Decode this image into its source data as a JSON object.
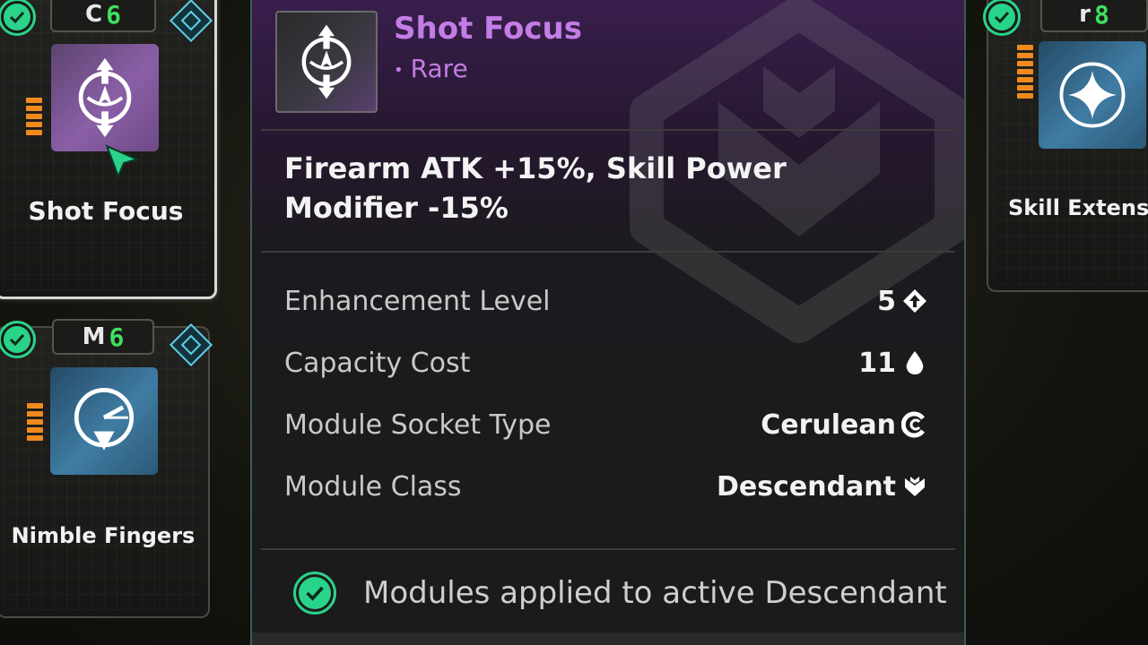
{
  "modules": {
    "shot_focus": {
      "name": "Shot Focus",
      "rarity": "Rare",
      "cost": "6",
      "socket_symbol": "C",
      "effect": "Firearm ATK +15%, Skill Power Modifier -15%",
      "enhancement_pips": 5
    },
    "nimble_fingers": {
      "name": "Nimble Fingers",
      "cost": "6",
      "socket_symbol": "M",
      "enhancement_pips": 5
    },
    "skill_extension": {
      "name": "Skill Extensi",
      "cost": "8",
      "socket_symbol": "r",
      "enhancement_pips": 7
    }
  },
  "detail": {
    "stats": [
      {
        "label": "Enhancement Level",
        "value": "5",
        "icon": "upgrade-icon"
      },
      {
        "label": "Capacity Cost",
        "value": "11",
        "icon": "drop-icon"
      },
      {
        "label": "Module Socket Type",
        "value": "Cerulean",
        "icon": "cerulean-socket-icon"
      },
      {
        "label": "Module Class",
        "value": "Descendant",
        "icon": "descendant-class-icon"
      }
    ],
    "footer": "Modules applied to active Descendant"
  },
  "colors": {
    "rare_purple": "#c37de6",
    "equipped_green": "#2ad38a",
    "cost_green": "#3fe05e",
    "pip_orange": "#f08a1c",
    "class_cyan": "#5fd0e8"
  }
}
